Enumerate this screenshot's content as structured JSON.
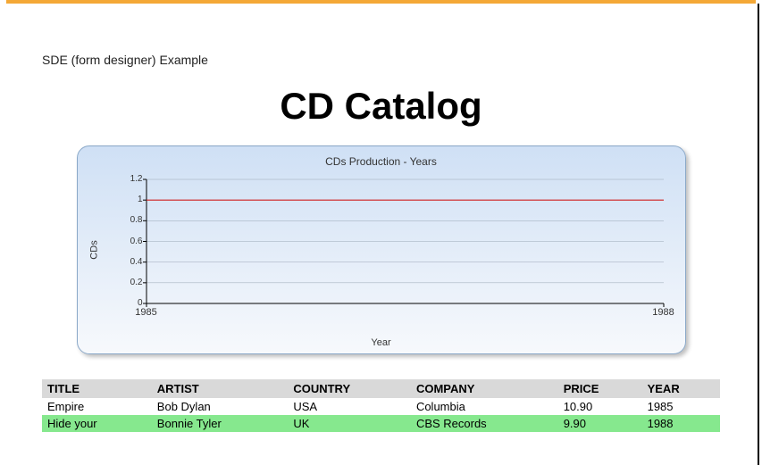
{
  "subtitle": "SDE (form designer) Example",
  "title": "CD Catalog",
  "chart_data": {
    "type": "line",
    "chart_title": "CDs Production - Years",
    "xlabel": "Year",
    "ylabel": "CDs",
    "ylim": [
      0,
      1.2
    ],
    "xlim": [
      1985,
      1988
    ],
    "y_ticks": [
      0,
      0.2,
      0.4,
      0.6,
      0.8,
      1,
      1.2
    ],
    "x_ticks": [
      1985,
      1988
    ],
    "series": [
      {
        "name": "CDs",
        "x": [
          1985,
          1988
        ],
        "y": [
          1,
          1
        ],
        "color": "#d02020"
      }
    ]
  },
  "table": {
    "headers": [
      "TITLE",
      "ARTIST",
      "COUNTRY",
      "COMPANY",
      "PRICE",
      "YEAR"
    ],
    "rows": [
      {
        "title": "Empire",
        "artist": "Bob Dylan",
        "country": "USA",
        "company": "Columbia",
        "price": "10.90",
        "year": "1985",
        "highlight": false
      },
      {
        "title": "Hide your",
        "artist": "Bonnie Tyler",
        "country": "UK",
        "company": "CBS Records",
        "price": "9.90",
        "year": "1988",
        "highlight": true
      }
    ]
  }
}
